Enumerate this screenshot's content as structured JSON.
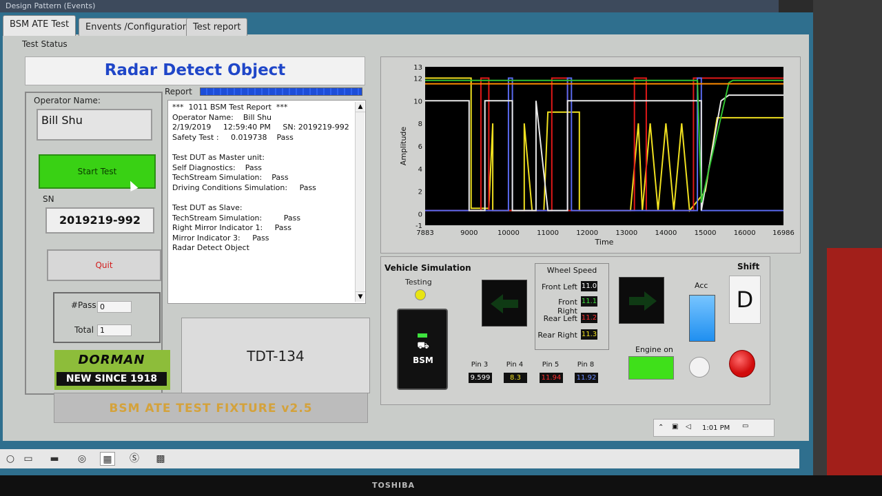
{
  "window": {
    "title": "Design Pattern (Events)"
  },
  "tabs": [
    {
      "label": "BSM  ATE  Test",
      "active": true
    },
    {
      "label": "Envents /Configuration",
      "active": false
    },
    {
      "label": "Test report",
      "active": false
    }
  ],
  "test_status_label": "Test Status",
  "banner_title": "Radar Detect Object",
  "operator": {
    "label": "Operator Name:",
    "value": "Bill Shu"
  },
  "start_button": "Start Test",
  "sn": {
    "label": "SN",
    "value": "2019219-992"
  },
  "quit_button": "Quit",
  "counts": {
    "pass_label": "#Pass",
    "pass_value": "0",
    "total_label": "Total",
    "total_value": "1"
  },
  "logo": {
    "line1": "DORMAN",
    "line2": "NEW SINCE 1918"
  },
  "report": {
    "label": "Report",
    "progress": 1.0,
    "text": "***  1011 BSM Test Report  ***\nOperator Name:    Bill Shu\n2/19/2019     12:59:40 PM     SN: 2019219-992\nSafety Test :     0.019738    Pass\n\nTest DUT as Master unit:\nSelf Diagnostics:    Pass\nTechStream Simulation:    Pass\nDriving Conditions Simulation:     Pass\n\nTest DUT as Slave:\nTechStream Simulation:         Pass\nRight Mirror Indicator 1:     Pass\nMirror Indicator 3:     Pass\nRadar Detect Object"
  },
  "fixture_id": "TDT-134",
  "footer_banner": "BSM ATE TEST FIXTURE v2.5",
  "chart_data": {
    "type": "line",
    "xlabel": "Time",
    "ylabel": "Amplitude",
    "xlim": [
      7883,
      16986
    ],
    "ylim": [
      -1,
      13
    ],
    "x_ticks": [
      "7883",
      "9000",
      "10000",
      "11000",
      "12000",
      "13000",
      "14000",
      "15000",
      "16000",
      "16986"
    ],
    "y_ticks": [
      "13",
      "12",
      "10",
      "8",
      "6",
      "4",
      "2",
      "0",
      "-1"
    ],
    "grid": false,
    "background": "#000000",
    "series": [
      {
        "color": "#f0e020",
        "x": [
          7883,
          9050,
          9050,
          9500,
          9600,
          9600,
          10400,
          10400,
          10600,
          10900,
          11000,
          11800,
          11800,
          12500,
          13100,
          13300,
          13400,
          13600,
          13800,
          14000,
          14200,
          14400,
          14600,
          15000,
          15300,
          15500,
          16986
        ],
        "y": [
          12,
          12,
          0.5,
          0.5,
          8,
          0.3,
          0.3,
          8,
          0.3,
          0.3,
          9,
          9,
          0.3,
          0.3,
          0.3,
          8,
          0.3,
          8,
          0.3,
          8,
          0.3,
          8,
          0.3,
          2,
          8.5,
          8.5,
          8.5
        ]
      },
      {
        "color": "#e01818",
        "x": [
          7883,
          9300,
          9300,
          9500,
          9500,
          11100,
          11100,
          11500,
          11500,
          13200,
          13200,
          13500,
          13500,
          14300,
          14300,
          14700,
          14700,
          16986
        ],
        "y": [
          0.3,
          0.3,
          12,
          12,
          0.3,
          0.3,
          12,
          12,
          0.3,
          0.3,
          12,
          12,
          0.3,
          0.3,
          0.3,
          0.3,
          12,
          12
        ]
      },
      {
        "color": "#5a6af0",
        "x": [
          7883,
          10000,
          10000,
          10100,
          10100,
          11500,
          11500,
          11600,
          11600,
          14800,
          14800,
          14900,
          14900,
          16986
        ],
        "y": [
          0.3,
          0.3,
          12,
          12,
          0.3,
          0.3,
          12,
          12,
          0.3,
          0.3,
          12,
          12,
          0.3,
          0.3
        ]
      },
      {
        "color": "#e8e8e8",
        "x": [
          7883,
          9000,
          9000,
          9400,
          9400,
          10100,
          10100,
          10700,
          10700,
          11000,
          11000,
          11500,
          11500,
          14900,
          14900,
          15400,
          15600,
          16986
        ],
        "y": [
          10,
          10,
          0.3,
          0.3,
          10,
          10,
          0.3,
          0.3,
          10,
          0.3,
          0.3,
          0.3,
          10,
          10,
          0.3,
          10,
          10.5,
          10.5
        ]
      },
      {
        "color": "#30c030",
        "x": [
          7883,
          9200,
          9200,
          14800,
          14900,
          15600,
          15700,
          16986
        ],
        "y": [
          11.8,
          11.8,
          11.8,
          11.8,
          1,
          11.6,
          11.8,
          11.8
        ]
      },
      {
        "color": "#ff8c00",
        "x": [
          7883,
          11000,
          11000,
          16986
        ],
        "y": [
          11.5,
          11.5,
          11.5,
          11.5
        ]
      }
    ]
  },
  "vehicle_sim": {
    "title": "Vehicle Simulation",
    "testing_label": "Testing",
    "bsm_label": "BSM",
    "wheel_speed": {
      "title": "Wheel Speed",
      "rows": [
        {
          "label": "Front Left",
          "value": "11.0",
          "color": "#ffffff"
        },
        {
          "label": "Front Right",
          "value": "11.1",
          "color": "#3ee23e"
        },
        {
          "label": "Rear Left",
          "value": "11.2",
          "color": "#ff3030"
        },
        {
          "label": "Rear Right",
          "value": "11.3",
          "color": "#f0e020"
        }
      ]
    },
    "pins": [
      {
        "label": "Pin 3",
        "value": "9.599",
        "color": "#ffffff"
      },
      {
        "label": "Pin 4",
        "value": "8.3",
        "color": "#f0e020"
      },
      {
        "label": "Pin 5",
        "value": "11.94",
        "color": "#ff3030"
      },
      {
        "label": "Pin 8",
        "value": "11.92",
        "color": "#6b8cff"
      }
    ],
    "acc_label": "Acc",
    "shift_label": "Shift",
    "shift_value": "D",
    "engine_label": "Engine on"
  },
  "tray": {
    "time": "1:01 PM"
  },
  "monitor_brand": "TOSHIBA"
}
